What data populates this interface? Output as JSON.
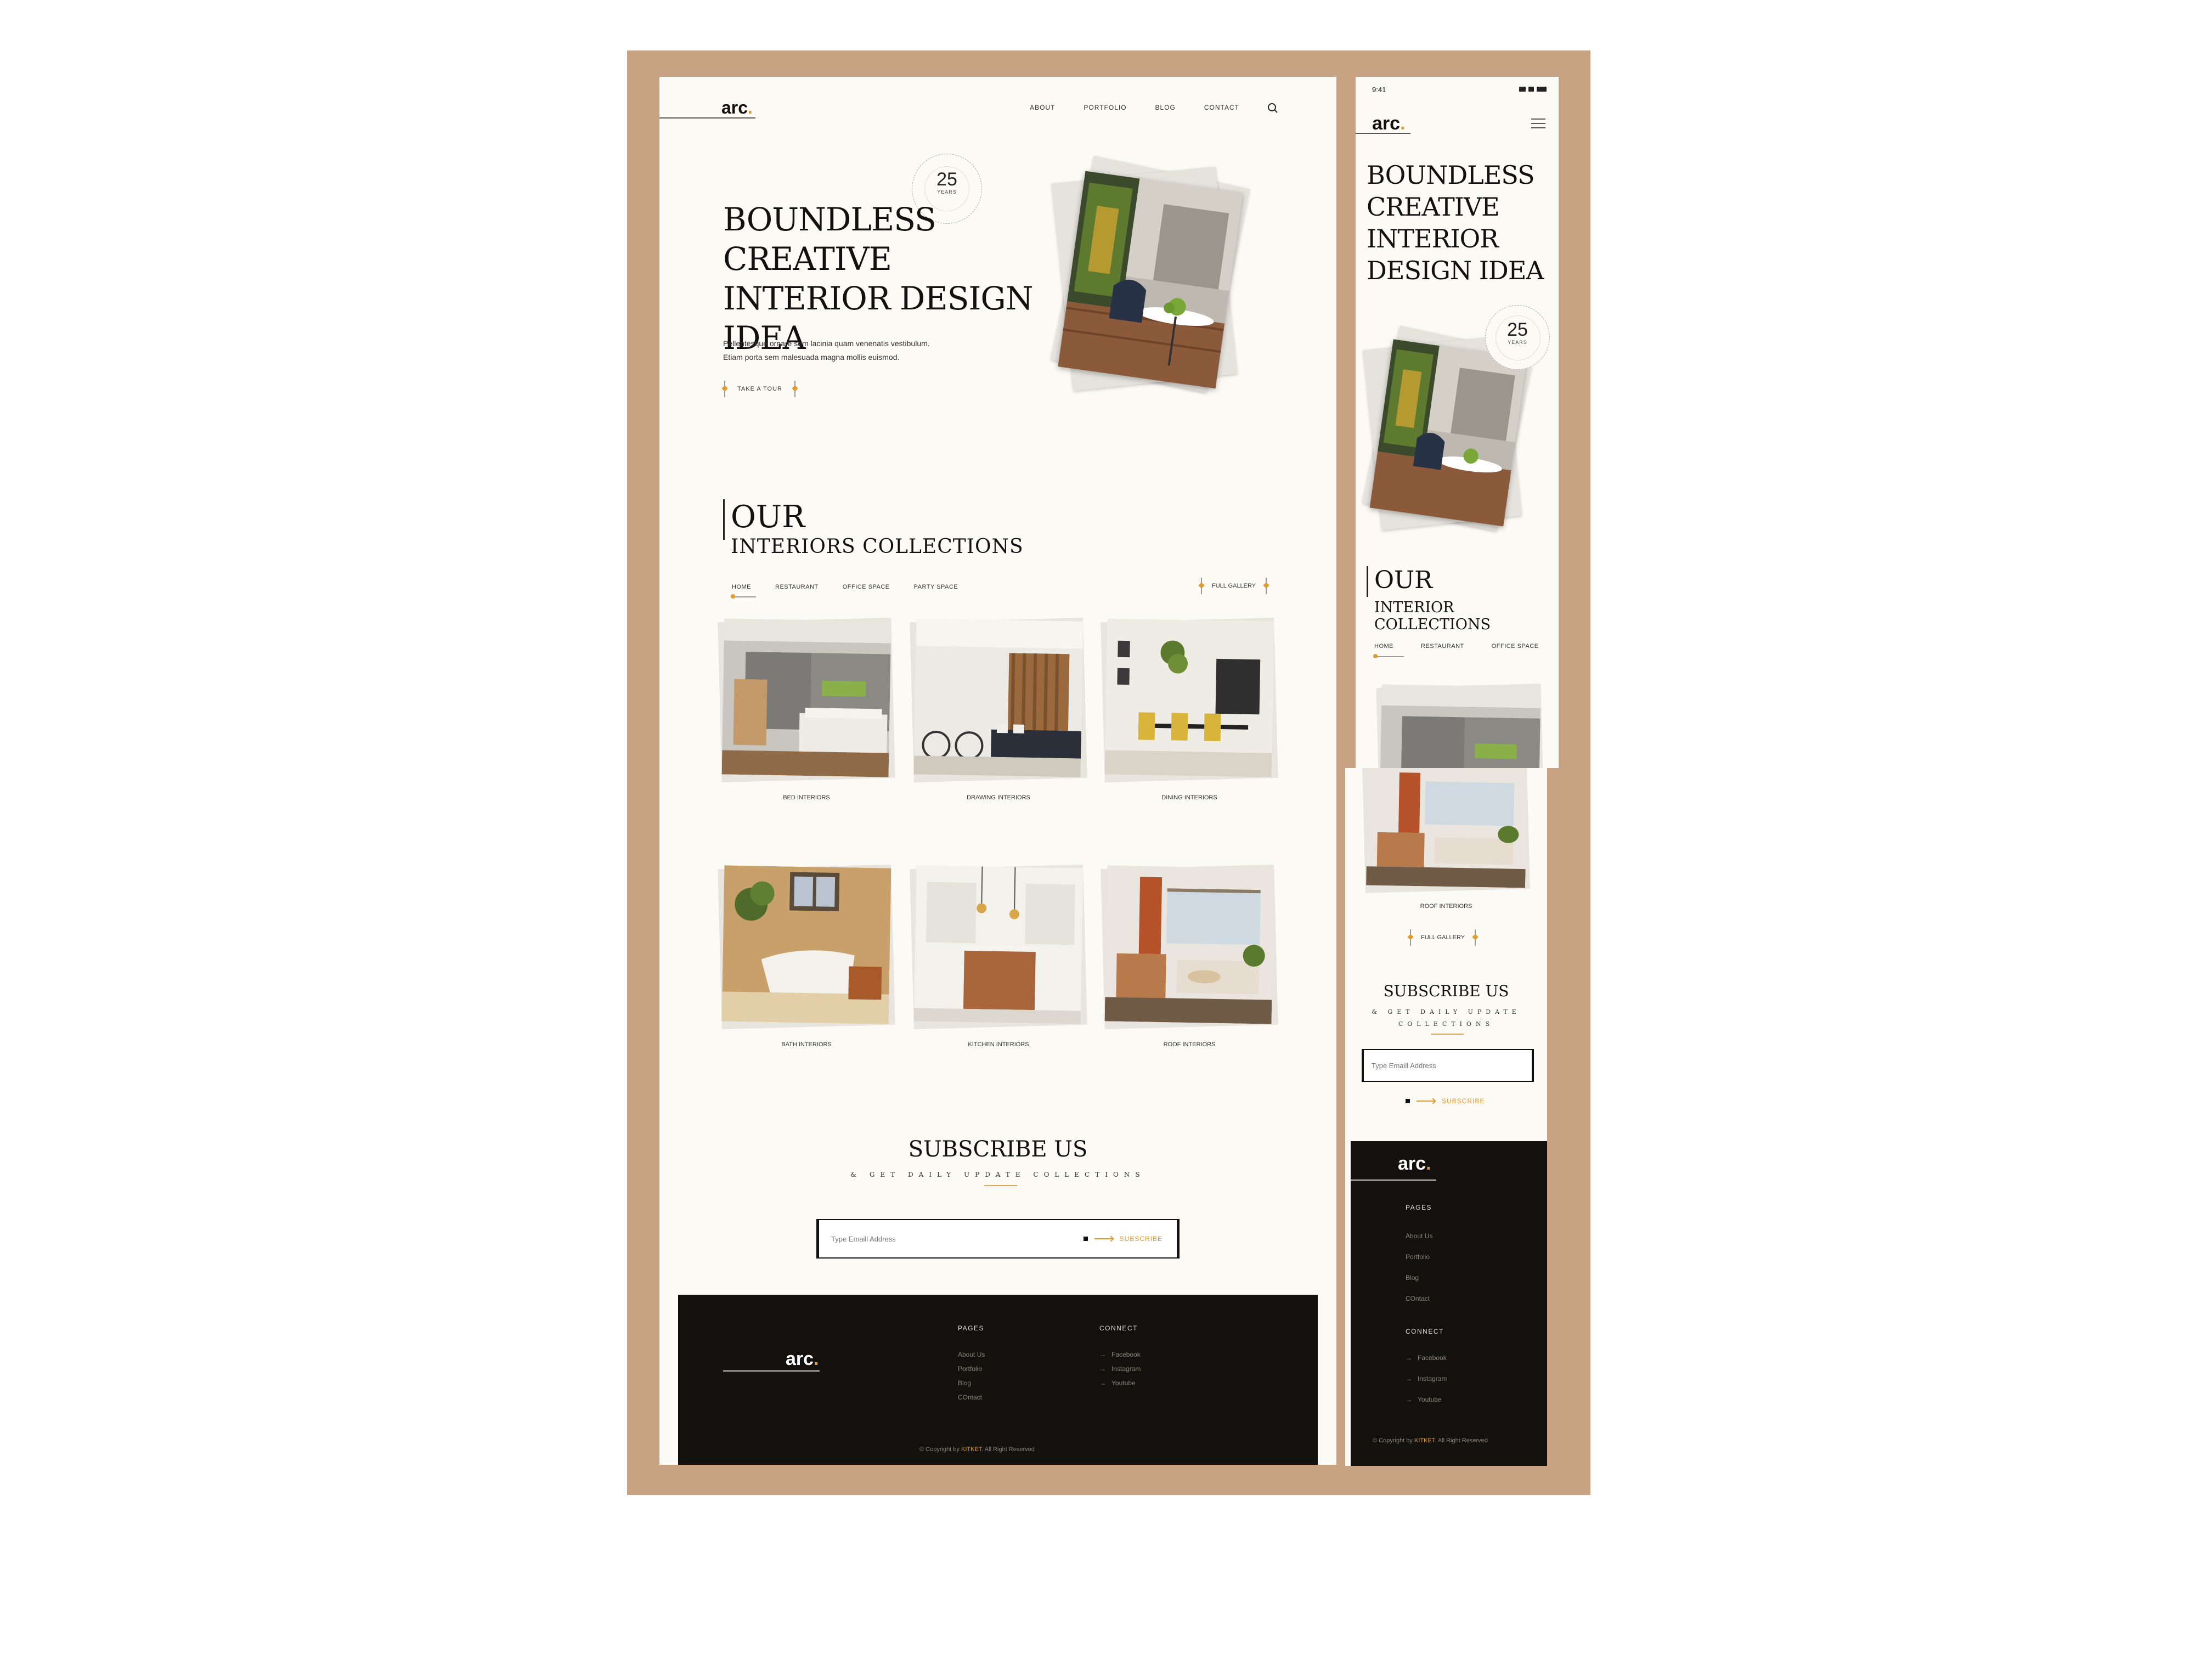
{
  "brand": {
    "logo": "arc",
    "logo_dot": "."
  },
  "nav": {
    "items": [
      "ABOUT",
      "PORTFOLIO",
      "BLOG",
      "CONTACT"
    ]
  },
  "badge": {
    "number": "25",
    "label": "YEARS"
  },
  "hero": {
    "title": "BOUNDLESS CREATIVE INTERIOR DESIGN IDEA",
    "desc_line1": "Pellentesque ornare sem lacinia quam venenatis vestibulum.",
    "desc_line2": "Etiam porta sem malesuada magna mollis euismod.",
    "cta": "TAKE A TOUR"
  },
  "collections": {
    "heading_top": "OUR",
    "heading_bottom": "INTERIORS COLLECTIONS",
    "mobile_heading_bottom": "INTERIOR COLLECTIONS",
    "tabs": [
      "HOME",
      "RESTAURANT",
      "OFFICE SPACE",
      "PARTY SPACE"
    ],
    "full_gallery": "FULL GALLERY",
    "cards": [
      "BED INTERIORS",
      "DRAWING INTERIORS",
      "DINING INTERIORS",
      "BATH INTERIORS",
      "KITCHEN INTERIORS",
      "ROOF INTERIORS"
    ]
  },
  "subscribe": {
    "title": "SUBSCRIBE US",
    "subtitle": "& GET DAILY UPDATE COLLECTIONS",
    "placeholder": "Type Emaill Address",
    "button": "SUBSCRIBE"
  },
  "footer": {
    "pages_heading": "PAGES",
    "pages": [
      "About Us",
      "Portfolio",
      "Blog",
      "COntact"
    ],
    "connect_heading": "CONNECT",
    "connect": [
      "Facebook",
      "Instagram",
      "Youtube"
    ],
    "copyright_prefix": "© Copyright by",
    "copyright_brand": "KITKET",
    "copyright_suffix": ". All Right Reserved"
  },
  "mobile": {
    "time": "9:41"
  },
  "colors": {
    "frame": "#c7a283",
    "page": "#fcfaf5",
    "accent": "#e29a2e",
    "footer": "#13110d"
  }
}
